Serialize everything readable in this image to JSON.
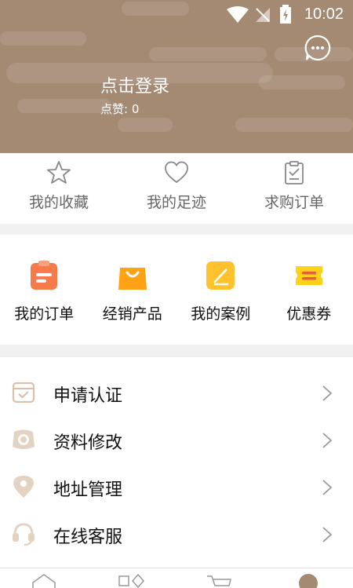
{
  "status_bar": {
    "time": "10:02"
  },
  "profile": {
    "login_prompt": "点击登录",
    "likes": "点赞: 0",
    "header_bg": "#a48a73"
  },
  "quick_links": [
    {
      "label": "我的收藏",
      "icon": "star-icon"
    },
    {
      "label": "我的足迹",
      "icon": "heart-icon"
    },
    {
      "label": "求购订单",
      "icon": "clipboard-check-icon"
    }
  ],
  "orders": [
    {
      "label": "我的订单",
      "icon": "order-icon",
      "color": "#f77a4b"
    },
    {
      "label": "经销产品",
      "icon": "shopping-bag-icon",
      "color": "#ffa214"
    },
    {
      "label": "我的案例",
      "icon": "case-icon",
      "color": "#ffc22c"
    },
    {
      "label": "优惠券",
      "icon": "coupon-icon",
      "color": "#ffd21a"
    }
  ],
  "menu": [
    {
      "label": "申请认证",
      "icon": "certification-icon"
    },
    {
      "label": "资料修改",
      "icon": "profile-edit-icon"
    },
    {
      "label": "地址管理",
      "icon": "location-icon"
    },
    {
      "label": "在线客服",
      "icon": "headset-icon"
    }
  ],
  "bottom_nav": [
    {
      "icon": "home-icon"
    },
    {
      "icon": "category-icon"
    },
    {
      "icon": "cart-icon"
    },
    {
      "icon": "profile-icon"
    }
  ]
}
